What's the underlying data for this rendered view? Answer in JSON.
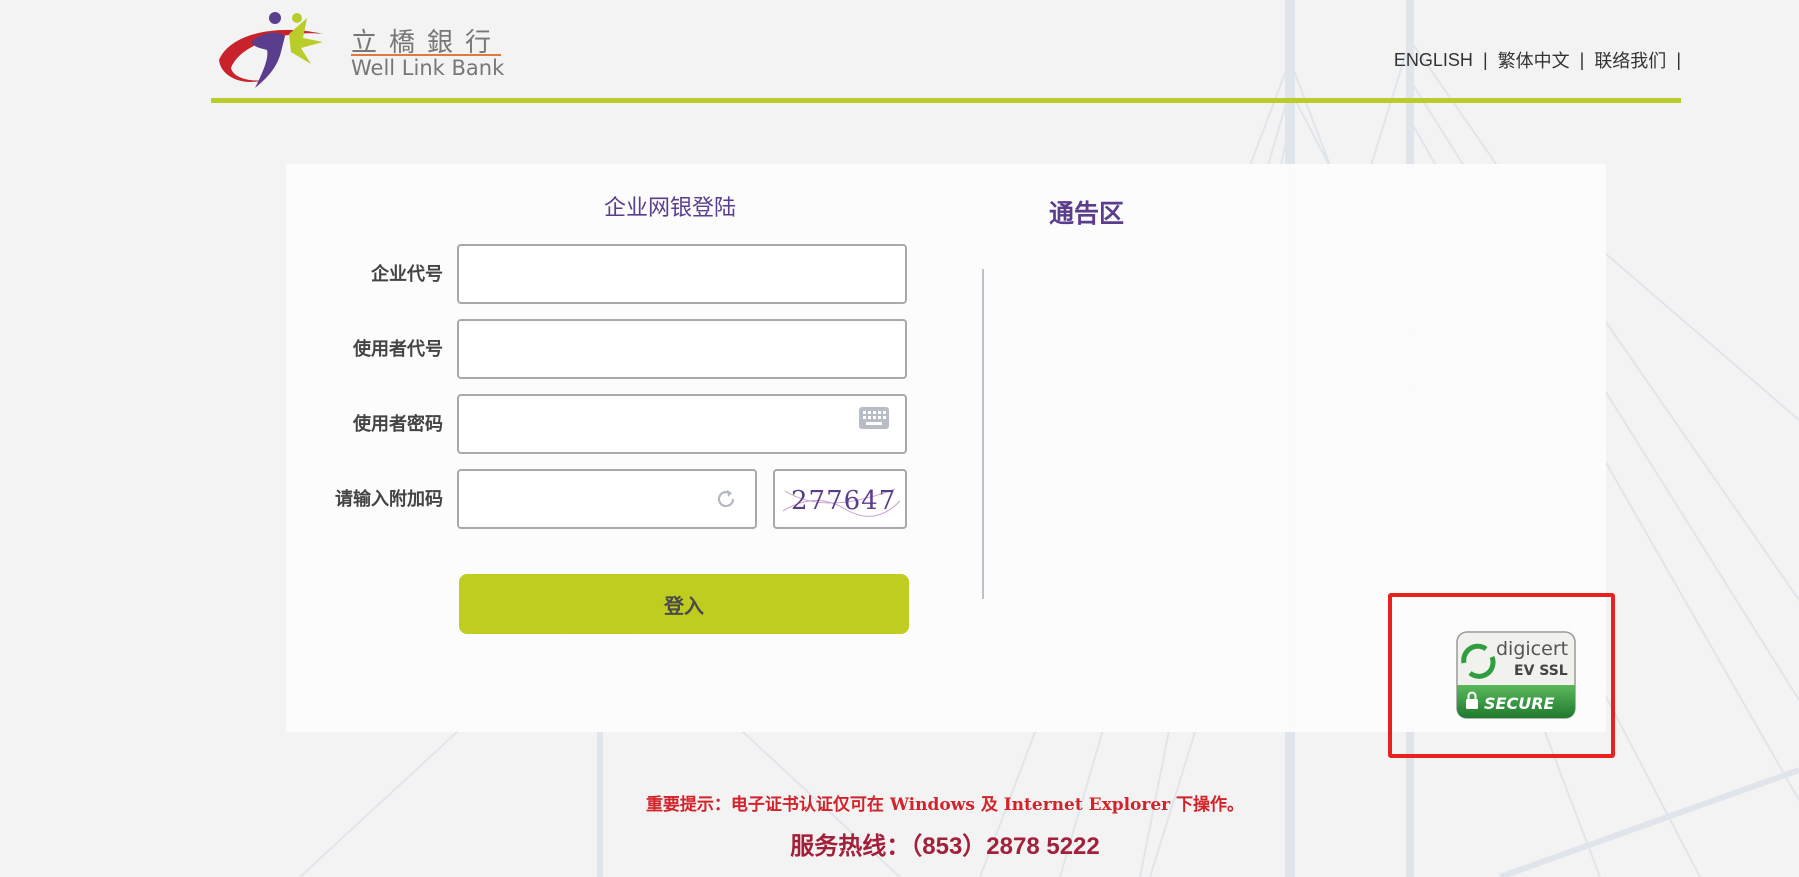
{
  "brand": {
    "name_cn": "立橋銀行",
    "name_en": "Well Link Bank",
    "primary_color": "#5a3d8c",
    "accent_color": "#b9cc2a"
  },
  "nav": {
    "english": "ENGLISH",
    "traditional": "繁体中文",
    "contact": "联络我们",
    "separator": "|"
  },
  "login": {
    "title": "企业网银登陆",
    "fields": {
      "company_id_label": "企业代号",
      "user_id_label": "使用者代号",
      "password_label": "使用者密码",
      "captcha_label": "请输入附加码"
    },
    "captcha_text": "277647",
    "submit_label": "登入"
  },
  "notice": {
    "title": "通告区"
  },
  "ssl_badge": {
    "brand": "digicert",
    "type": "EV SSL",
    "status": "SECURE"
  },
  "footer": {
    "notice": "重要提示：电子证书认证仅可在 Windows 及 Internet Explorer 下操作。",
    "hotline": "服务热线：（853）2878 5222"
  },
  "icons": [
    "keyboard-icon",
    "refresh-icon",
    "lock-icon"
  ]
}
